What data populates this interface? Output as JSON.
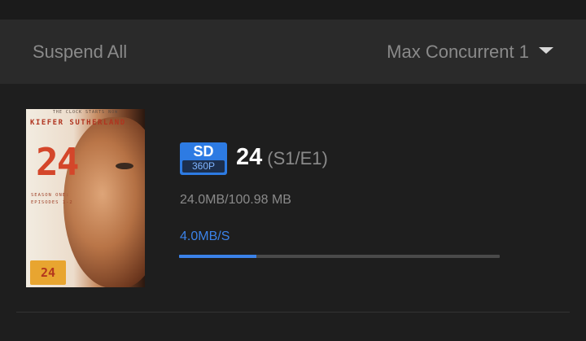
{
  "toolbar": {
    "suspend_all_label": "Suspend All",
    "max_concurrent_label": "Max Concurrent 1"
  },
  "download": {
    "poster": {
      "tagline": "THE CLOCK STARTS NOW",
      "actor": "KIEFER SUTHERLAND",
      "number": "24",
      "season_line1": "SEASON ONE:",
      "season_line2": "EPISODES 1-2",
      "badge": "24"
    },
    "quality": {
      "label": "SD",
      "resolution": "360P"
    },
    "title": "24",
    "episode": "(S1/E1)",
    "size": "24.0MB/100.98 MB",
    "speed": "4.0MB/S",
    "progress": 0.24
  },
  "colors": {
    "accent": "#3b82e8",
    "background": "#1e1e1e",
    "toolbar": "#2a2a2a"
  }
}
